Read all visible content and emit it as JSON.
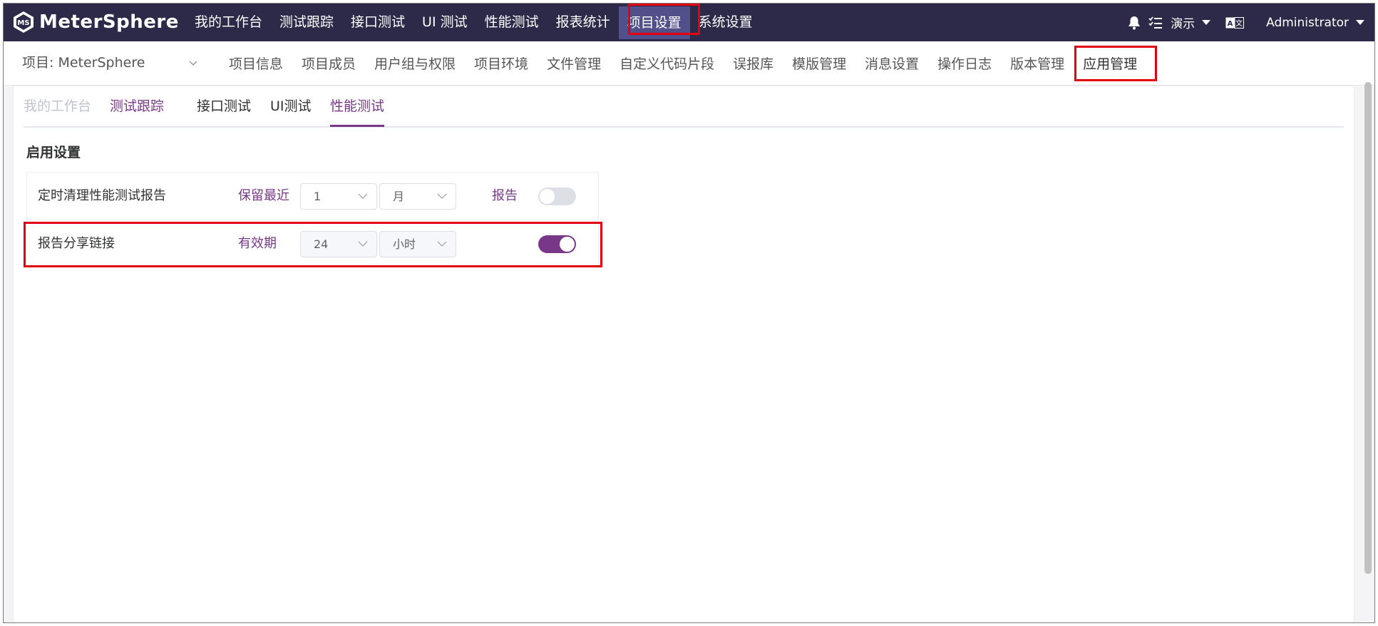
{
  "app": {
    "brand": "MeterSphere",
    "colors": {
      "header_bg": "#2c2a48",
      "accent": "#783887",
      "active_nav_bg": "#51508a",
      "highlight": "#e3000f"
    }
  },
  "topnav": {
    "items": [
      "我的工作台",
      "测试跟踪",
      "接口测试",
      "UI 测试",
      "性能测试",
      "报表统计",
      "项目设置",
      "系统设置"
    ],
    "active": "项目设置"
  },
  "topright": {
    "bell_icon": "bell-icon",
    "task_icon": "task-list-icon",
    "workspace": "演示",
    "lang_icon": "language-icon",
    "user": "Administrator"
  },
  "subnav": {
    "project_label": "项目: MeterSphere",
    "items": [
      "项目信息",
      "项目成员",
      "用户组与权限",
      "项目环境",
      "文件管理",
      "自定义代码片段",
      "误报库",
      "模版管理",
      "消息设置",
      "操作日志",
      "版本管理",
      "应用管理"
    ],
    "active": "应用管理"
  },
  "tabs": {
    "items": [
      "我的工作台",
      "测试跟踪",
      "接口测试",
      "UI测试",
      "性能测试"
    ],
    "active": "性能测试"
  },
  "section": {
    "title": "启用设置"
  },
  "settings": [
    {
      "label": "定时清理性能测试报告",
      "sublabel": "保留最近",
      "value": "1",
      "unit": "月",
      "right_label": "报告",
      "enabled": false
    },
    {
      "label": "报告分享链接",
      "sublabel": "有效期",
      "value": "24",
      "unit": "小时",
      "right_label": "",
      "enabled": true
    }
  ]
}
